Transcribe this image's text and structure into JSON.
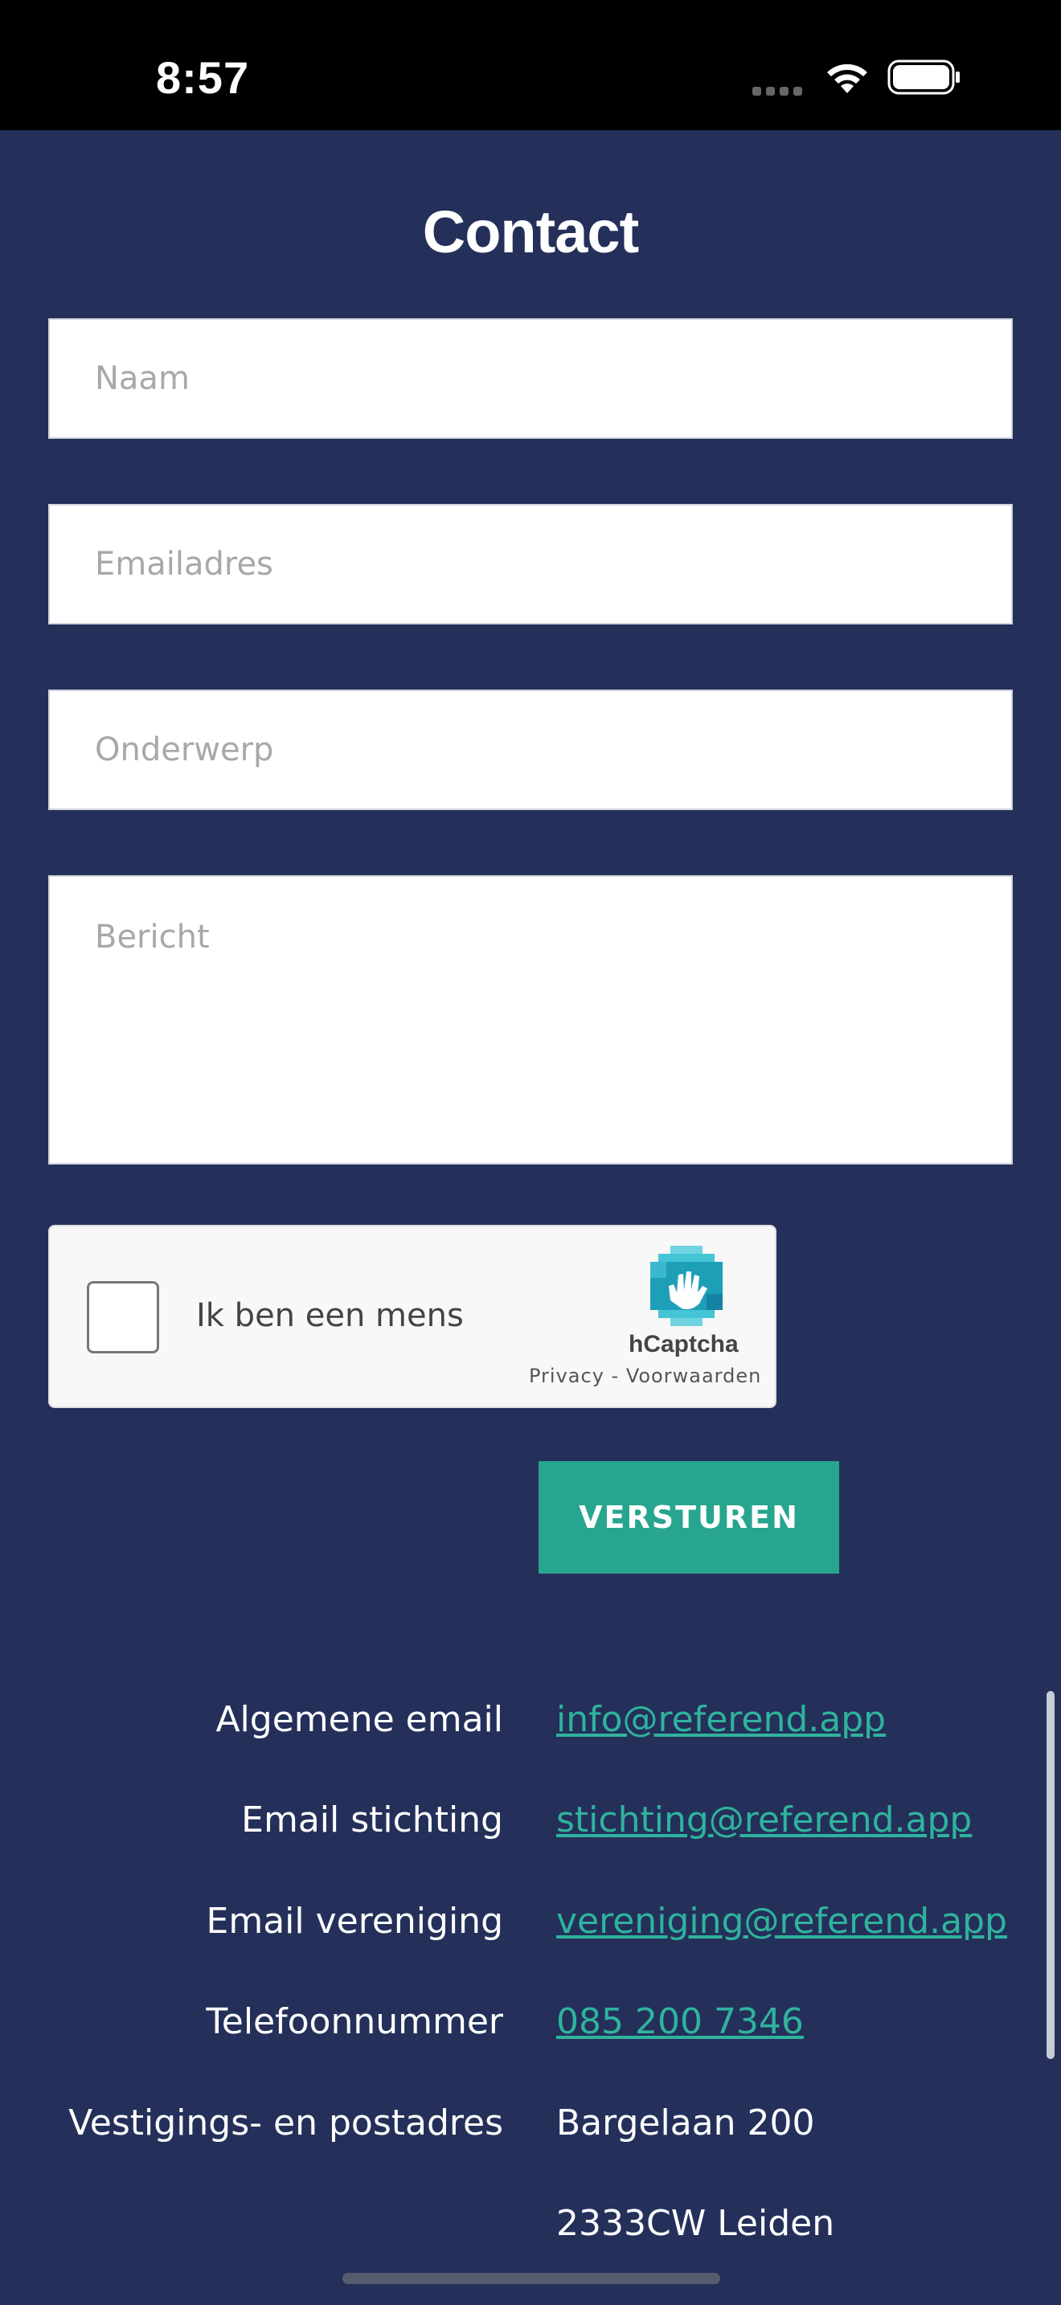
{
  "status_bar": {
    "time": "8:57",
    "icons": [
      "signal-icon",
      "wifi-icon",
      "battery-icon"
    ]
  },
  "page": {
    "title": "Contact"
  },
  "form": {
    "name_placeholder": "Naam",
    "email_placeholder": "Emailadres",
    "subject_placeholder": "Onderwerp",
    "message_placeholder": "Bericht",
    "submit_label": "VERSTUREN"
  },
  "captcha": {
    "label": "Ik ben een mens",
    "brand": "hCaptcha",
    "links": "Privacy - Voorwaarden"
  },
  "contact": {
    "general_email_label": "Algemene email",
    "general_email": "info@referend.app",
    "foundation_email_label": "Email stichting",
    "foundation_email": "stichting@referend.app",
    "association_email_label": "Email vereniging",
    "association_email": "vereniging@referend.app",
    "phone_label": "Telefoonnummer",
    "phone": "085 200 7346",
    "address_label": "Vestigings- en postadres",
    "address_line1": "Bargelaan 200",
    "address_line2": "2333CW Leiden"
  },
  "colors": {
    "background": "#24305a",
    "accent": "#27a58e",
    "link": "#2fb39d"
  }
}
